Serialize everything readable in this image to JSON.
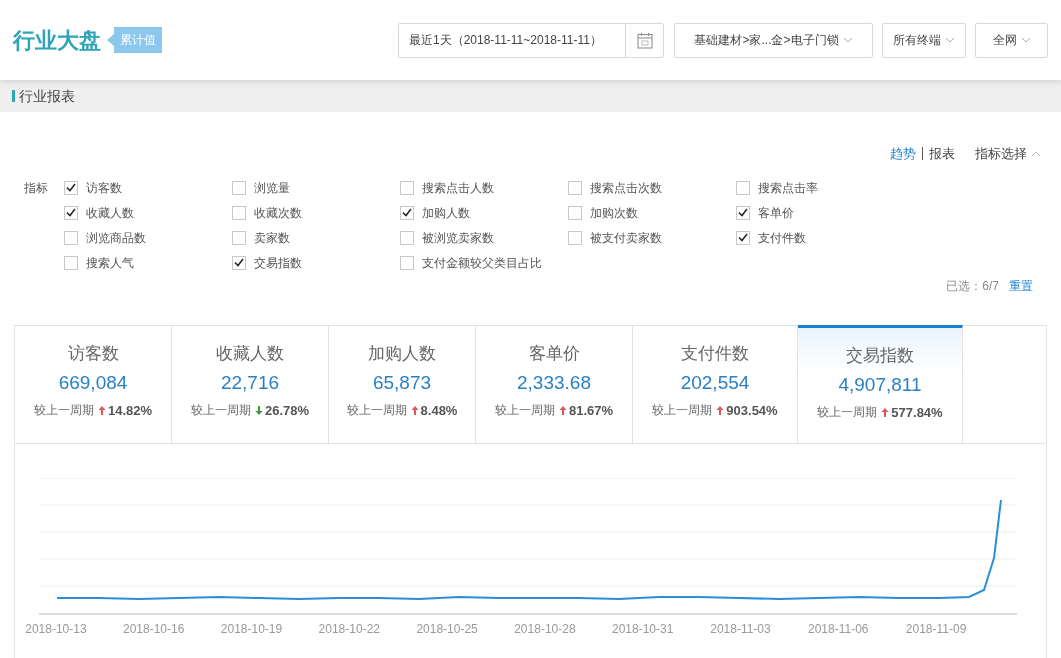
{
  "header": {
    "title": "行业大盘",
    "badge": "累计值",
    "date_range": "最近1天（2018-11-11~2018-11-11）",
    "category": "基础建材>家...金>电子门锁",
    "terminal": "所有终端",
    "network": "全网"
  },
  "section_title": "行业报表",
  "view_toggle": [
    {
      "label": "趋势",
      "selected": true
    },
    {
      "label": "报表",
      "selected": false
    }
  ],
  "metric_select": "指标选择",
  "metrics_label": "指标",
  "metrics": [
    {
      "label": "访客数",
      "checked": true
    },
    {
      "label": "浏览量",
      "checked": false
    },
    {
      "label": "搜索点击人数",
      "checked": false
    },
    {
      "label": "搜索点击次数",
      "checked": false
    },
    {
      "label": "搜索点击率",
      "checked": false
    },
    {
      "label": "收藏人数",
      "checked": true
    },
    {
      "label": "收藏次数",
      "checked": false
    },
    {
      "label": "加购人数",
      "checked": true
    },
    {
      "label": "加购次数",
      "checked": false
    },
    {
      "label": "客单价",
      "checked": true
    },
    {
      "label": "浏览商品数",
      "checked": false
    },
    {
      "label": "卖家数",
      "checked": false
    },
    {
      "label": "被浏览卖家数",
      "checked": false
    },
    {
      "label": "被支付卖家数",
      "checked": false
    },
    {
      "label": "支付件数",
      "checked": true
    },
    {
      "label": "搜索人气",
      "checked": false
    },
    {
      "label": "交易指数",
      "checked": true
    },
    {
      "label": "支付金额较父类目占比",
      "checked": false
    }
  ],
  "selected_count": "已选：6/7",
  "reset": "重置",
  "kpis": [
    {
      "title": "访客数",
      "value": "669,084",
      "compare": "较上一周期",
      "increase": true,
      "change": "14.82%",
      "selected": false
    },
    {
      "title": "收藏人数",
      "value": "22,716",
      "compare": "较上一周期",
      "increase": false,
      "change": "26.78%",
      "selected": false
    },
    {
      "title": "加购人数",
      "value": "65,873",
      "compare": "较上一周期",
      "increase": true,
      "change": "8.48%",
      "selected": false
    },
    {
      "title": "客单价",
      "value": "2,333.68",
      "compare": "较上一周期",
      "increase": true,
      "change": "81.67%",
      "selected": false
    },
    {
      "title": "支付件数",
      "value": "202,554",
      "compare": "较上一周期",
      "increase": true,
      "change": "903.54%",
      "selected": false
    },
    {
      "title": "交易指数",
      "value": "4,907,811",
      "compare": "较上一周期",
      "increase": true,
      "change": "577.84%",
      "selected": true
    }
  ],
  "chart_x_labels": [
    "2018-10-13",
    "2018-10-16",
    "2018-10-19",
    "2018-10-22",
    "2018-10-25",
    "2018-10-28",
    "2018-10-31",
    "2018-11-03",
    "2018-11-06",
    "2018-11-09"
  ]
}
